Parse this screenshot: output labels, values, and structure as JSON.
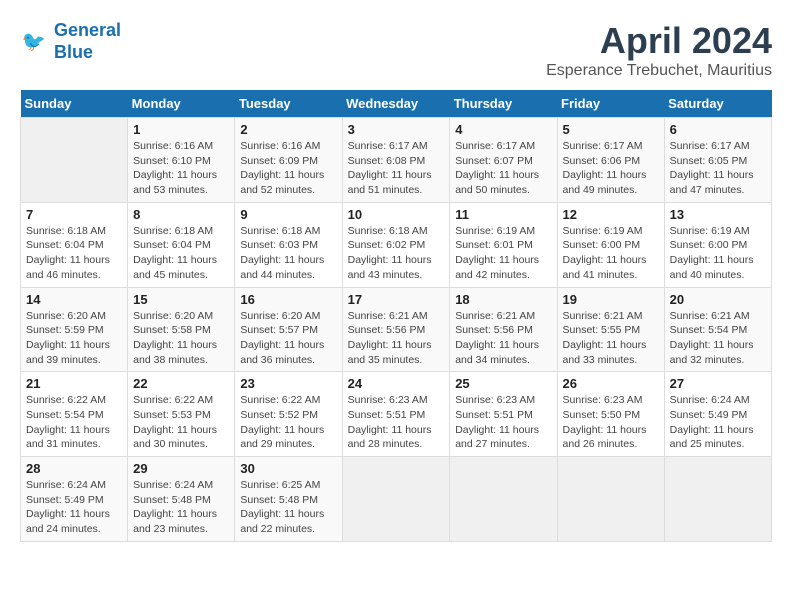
{
  "logo": {
    "line1": "General",
    "line2": "Blue"
  },
  "title": "April 2024",
  "subtitle": "Esperance Trebuchet, Mauritius",
  "days_header": [
    "Sunday",
    "Monday",
    "Tuesday",
    "Wednesday",
    "Thursday",
    "Friday",
    "Saturday"
  ],
  "weeks": [
    [
      {
        "num": "",
        "info": ""
      },
      {
        "num": "1",
        "info": "Sunrise: 6:16 AM\nSunset: 6:10 PM\nDaylight: 11 hours\nand 53 minutes."
      },
      {
        "num": "2",
        "info": "Sunrise: 6:16 AM\nSunset: 6:09 PM\nDaylight: 11 hours\nand 52 minutes."
      },
      {
        "num": "3",
        "info": "Sunrise: 6:17 AM\nSunset: 6:08 PM\nDaylight: 11 hours\nand 51 minutes."
      },
      {
        "num": "4",
        "info": "Sunrise: 6:17 AM\nSunset: 6:07 PM\nDaylight: 11 hours\nand 50 minutes."
      },
      {
        "num": "5",
        "info": "Sunrise: 6:17 AM\nSunset: 6:06 PM\nDaylight: 11 hours\nand 49 minutes."
      },
      {
        "num": "6",
        "info": "Sunrise: 6:17 AM\nSunset: 6:05 PM\nDaylight: 11 hours\nand 47 minutes."
      }
    ],
    [
      {
        "num": "7",
        "info": "Sunrise: 6:18 AM\nSunset: 6:04 PM\nDaylight: 11 hours\nand 46 minutes."
      },
      {
        "num": "8",
        "info": "Sunrise: 6:18 AM\nSunset: 6:04 PM\nDaylight: 11 hours\nand 45 minutes."
      },
      {
        "num": "9",
        "info": "Sunrise: 6:18 AM\nSunset: 6:03 PM\nDaylight: 11 hours\nand 44 minutes."
      },
      {
        "num": "10",
        "info": "Sunrise: 6:18 AM\nSunset: 6:02 PM\nDaylight: 11 hours\nand 43 minutes."
      },
      {
        "num": "11",
        "info": "Sunrise: 6:19 AM\nSunset: 6:01 PM\nDaylight: 11 hours\nand 42 minutes."
      },
      {
        "num": "12",
        "info": "Sunrise: 6:19 AM\nSunset: 6:00 PM\nDaylight: 11 hours\nand 41 minutes."
      },
      {
        "num": "13",
        "info": "Sunrise: 6:19 AM\nSunset: 6:00 PM\nDaylight: 11 hours\nand 40 minutes."
      }
    ],
    [
      {
        "num": "14",
        "info": "Sunrise: 6:20 AM\nSunset: 5:59 PM\nDaylight: 11 hours\nand 39 minutes."
      },
      {
        "num": "15",
        "info": "Sunrise: 6:20 AM\nSunset: 5:58 PM\nDaylight: 11 hours\nand 38 minutes."
      },
      {
        "num": "16",
        "info": "Sunrise: 6:20 AM\nSunset: 5:57 PM\nDaylight: 11 hours\nand 36 minutes."
      },
      {
        "num": "17",
        "info": "Sunrise: 6:21 AM\nSunset: 5:56 PM\nDaylight: 11 hours\nand 35 minutes."
      },
      {
        "num": "18",
        "info": "Sunrise: 6:21 AM\nSunset: 5:56 PM\nDaylight: 11 hours\nand 34 minutes."
      },
      {
        "num": "19",
        "info": "Sunrise: 6:21 AM\nSunset: 5:55 PM\nDaylight: 11 hours\nand 33 minutes."
      },
      {
        "num": "20",
        "info": "Sunrise: 6:21 AM\nSunset: 5:54 PM\nDaylight: 11 hours\nand 32 minutes."
      }
    ],
    [
      {
        "num": "21",
        "info": "Sunrise: 6:22 AM\nSunset: 5:54 PM\nDaylight: 11 hours\nand 31 minutes."
      },
      {
        "num": "22",
        "info": "Sunrise: 6:22 AM\nSunset: 5:53 PM\nDaylight: 11 hours\nand 30 minutes."
      },
      {
        "num": "23",
        "info": "Sunrise: 6:22 AM\nSunset: 5:52 PM\nDaylight: 11 hours\nand 29 minutes."
      },
      {
        "num": "24",
        "info": "Sunrise: 6:23 AM\nSunset: 5:51 PM\nDaylight: 11 hours\nand 28 minutes."
      },
      {
        "num": "25",
        "info": "Sunrise: 6:23 AM\nSunset: 5:51 PM\nDaylight: 11 hours\nand 27 minutes."
      },
      {
        "num": "26",
        "info": "Sunrise: 6:23 AM\nSunset: 5:50 PM\nDaylight: 11 hours\nand 26 minutes."
      },
      {
        "num": "27",
        "info": "Sunrise: 6:24 AM\nSunset: 5:49 PM\nDaylight: 11 hours\nand 25 minutes."
      }
    ],
    [
      {
        "num": "28",
        "info": "Sunrise: 6:24 AM\nSunset: 5:49 PM\nDaylight: 11 hours\nand 24 minutes."
      },
      {
        "num": "29",
        "info": "Sunrise: 6:24 AM\nSunset: 5:48 PM\nDaylight: 11 hours\nand 23 minutes."
      },
      {
        "num": "30",
        "info": "Sunrise: 6:25 AM\nSunset: 5:48 PM\nDaylight: 11 hours\nand 22 minutes."
      },
      {
        "num": "",
        "info": ""
      },
      {
        "num": "",
        "info": ""
      },
      {
        "num": "",
        "info": ""
      },
      {
        "num": "",
        "info": ""
      }
    ]
  ]
}
